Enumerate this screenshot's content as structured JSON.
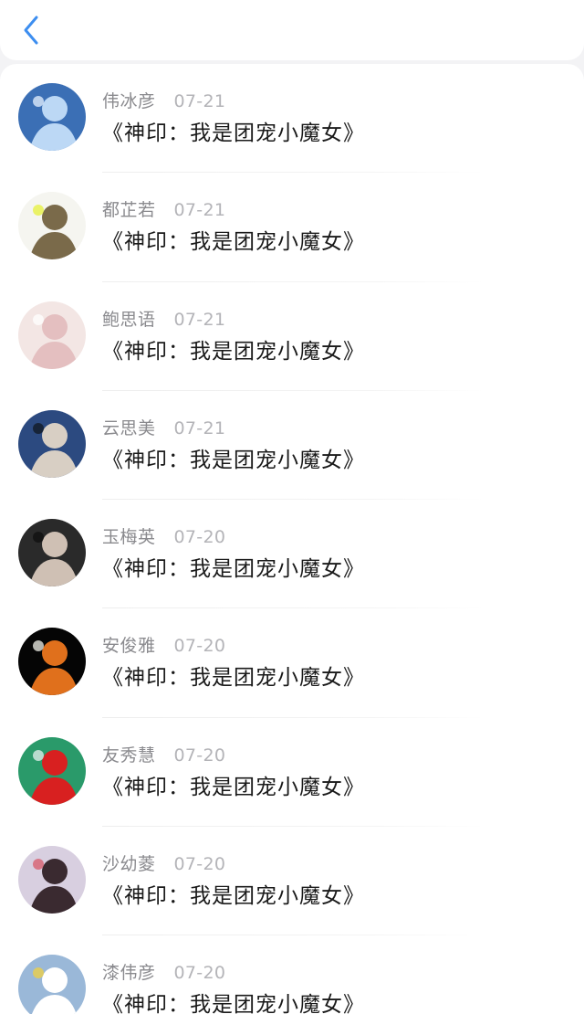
{
  "header": {
    "back_icon": "chevron-left-icon",
    "accent": "#3d8ef0"
  },
  "messages": [
    {
      "name": "伟冰彦",
      "date": "07-21",
      "text": "《神印：我是团宠小魔女》",
      "avatar": {
        "bg": "#3b6fb5",
        "fg": "#bcd8f5",
        "accent": "#e8f2ff"
      }
    },
    {
      "name": "都芷若",
      "date": "07-21",
      "text": "《神印：我是团宠小魔女》",
      "avatar": {
        "bg": "#f5f5f0",
        "fg": "#7a6a4a",
        "accent": "#e6f03a"
      }
    },
    {
      "name": "鲍思语",
      "date": "07-21",
      "text": "《神印：我是团宠小魔女》",
      "avatar": {
        "bg": "#f3e6e4",
        "fg": "#e4bfc0",
        "accent": "#ffffff"
      }
    },
    {
      "name": "云思美",
      "date": "07-21",
      "text": "《神印：我是团宠小魔女》",
      "avatar": {
        "bg": "#2c4a80",
        "fg": "#d8cfc4",
        "accent": "#101820"
      }
    },
    {
      "name": "玉梅英",
      "date": "07-20",
      "text": "《神印：我是团宠小魔女》",
      "avatar": {
        "bg": "#2a2a2a",
        "fg": "#cfc0b4",
        "accent": "#0f0f0f"
      }
    },
    {
      "name": "安俊雅",
      "date": "07-20",
      "text": "《神印：我是团宠小魔女》",
      "avatar": {
        "bg": "#050505",
        "fg": "#e0701c",
        "accent": "#f2f2ea"
      }
    },
    {
      "name": "友秀慧",
      "date": "07-20",
      "text": "《神印：我是团宠小魔女》",
      "avatar": {
        "bg": "#2a9a6a",
        "fg": "#d82020",
        "accent": "#e8f0f0"
      }
    },
    {
      "name": "沙幼菱",
      "date": "07-20",
      "text": "《神印：我是团宠小魔女》",
      "avatar": {
        "bg": "#d8cfe0",
        "fg": "#3a2a30",
        "accent": "#d85a6a"
      }
    },
    {
      "name": "漆伟彦",
      "date": "07-20",
      "text": "《神印：我是团宠小魔女》",
      "avatar": {
        "bg": "#9ab8d8",
        "fg": "#ffffff",
        "accent": "#f0d040"
      }
    }
  ]
}
